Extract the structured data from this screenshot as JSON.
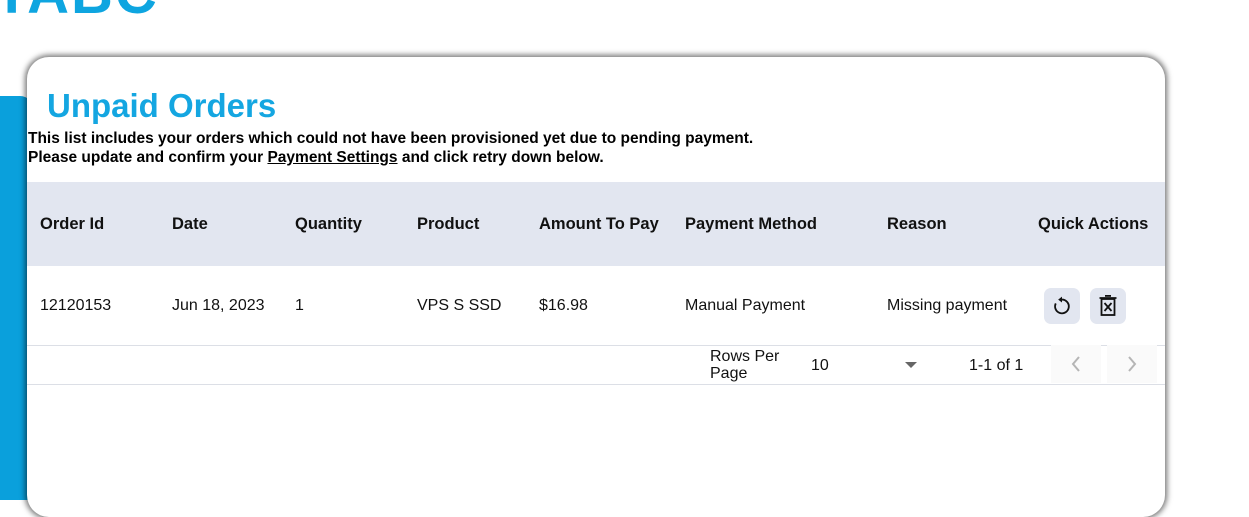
{
  "brand": {
    "text": "TABC"
  },
  "page": {
    "title": "Unpaid Orders",
    "desc_line1": "This list includes your orders which could not have been provisioned yet due to pending payment.",
    "desc_line2_prefix": "Please update and confirm your ",
    "desc_link": "Payment Settings",
    "desc_line2_suffix": " and click retry down below."
  },
  "table": {
    "headers": {
      "order_id": "Order Id",
      "date": "Date",
      "quantity": "Quantity",
      "product": "Product",
      "amount": "Amount To Pay",
      "payment_method": "Payment Method",
      "reason": "Reason",
      "quick_actions": "Quick Actions"
    },
    "rows": [
      {
        "order_id": "12120153",
        "date": "Jun 18, 2023",
        "quantity": "1",
        "product": "VPS S SSD",
        "amount": "$16.98",
        "payment_method": "Manual Payment",
        "reason": "Missing payment"
      }
    ]
  },
  "actions": {
    "retry_icon": "retry-icon",
    "delete_icon": "delete-icon"
  },
  "pagination": {
    "rows_per_page_line1": "Rows Per",
    "rows_per_page_line2": "Page",
    "rows_per_page_value": "10",
    "range": "1-1 of 1"
  },
  "colors": {
    "accent": "#14a6e1",
    "header_bg": "#e2e6f0",
    "stripe": "#0aa0dc"
  }
}
